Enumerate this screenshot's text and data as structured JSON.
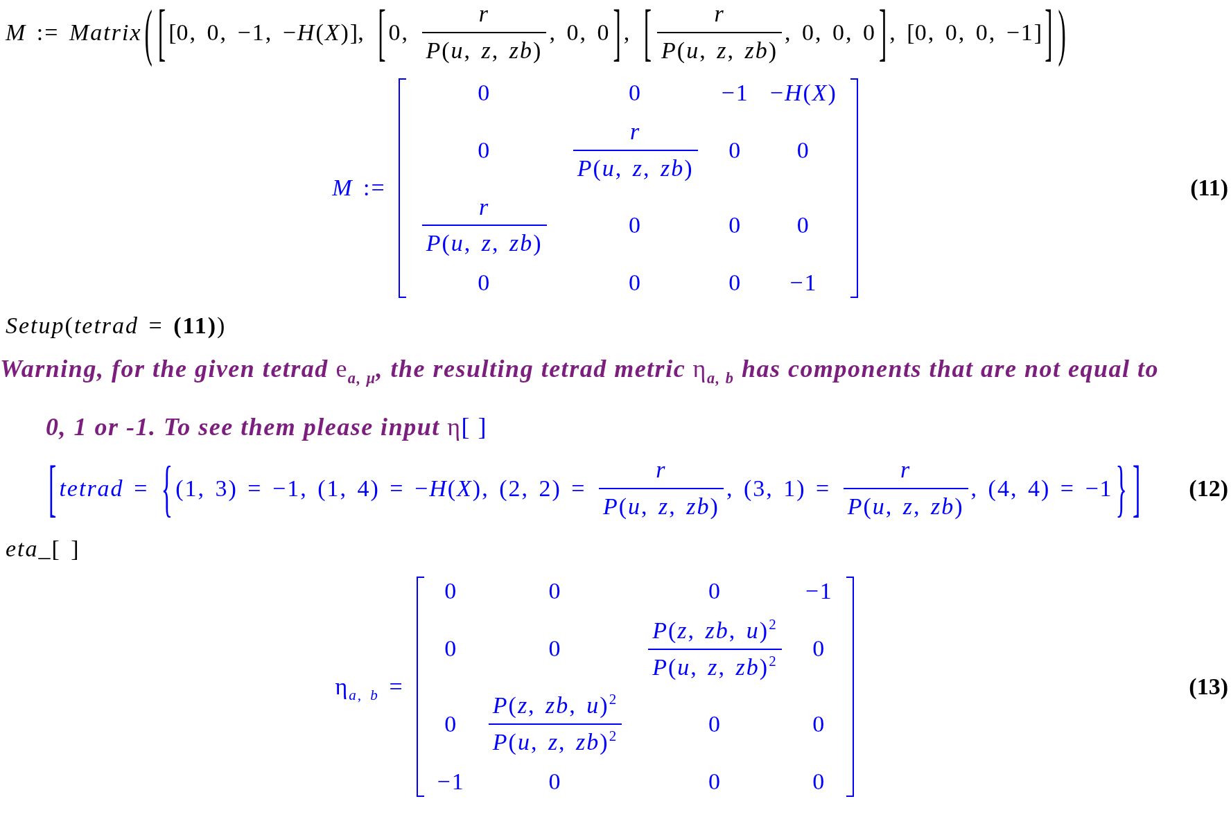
{
  "worksheet": [
    {
      "kind": "input",
      "expr": [
        {
          "kind": "text",
          "text": "*M* := *Matrix*"
        },
        {
          "kind": "fence",
          "open": "(",
          "close": ")",
          "body": [
            {
              "kind": "fence",
              "open": "[",
              "close": "]",
              "body": [
                {
                  "kind": "fence",
                  "open": "[",
                  "close": "]",
                  "body": [
                    {
                      "kind": "text",
                      "text": "0, 0, −1, −*H*(*X*)"
                    }
                  ]
                },
                {
                  "kind": "text",
                  "text": ", "
                },
                {
                  "kind": "fence",
                  "open": "[",
                  "close": "]",
                  "body": [
                    {
                      "kind": "text",
                      "text": "0, "
                    },
                    {
                      "kind": "frac",
                      "num": "*r*",
                      "den": "*P*(*u*, *z*, *zb*)"
                    },
                    {
                      "kind": "text",
                      "text": ", 0, 0"
                    }
                  ]
                },
                {
                  "kind": "text",
                  "text": ", "
                },
                {
                  "kind": "fence",
                  "open": "[",
                  "close": "]",
                  "body": [
                    {
                      "kind": "frac",
                      "num": "*r*",
                      "den": "*P*(*u*, *z*, *zb*)"
                    },
                    {
                      "kind": "text",
                      "text": ", 0, 0, 0"
                    }
                  ]
                },
                {
                  "kind": "text",
                  "text": ", "
                },
                {
                  "kind": "fence",
                  "open": "[",
                  "close": "]",
                  "body": [
                    {
                      "kind": "text",
                      "text": "0, 0, 0, −1"
                    }
                  ]
                }
              ]
            }
          ]
        }
      ]
    },
    {
      "kind": "output",
      "label": "(11)",
      "expr": [
        {
          "kind": "text",
          "text": "*M* :="
        },
        {
          "kind": "matrix",
          "rows": [
            [
              {
                "kind": "text",
                "text": "0"
              },
              {
                "kind": "text",
                "text": "0"
              },
              {
                "kind": "text",
                "text": "−1"
              },
              {
                "kind": "text",
                "text": "−*H*(*X*)"
              }
            ],
            [
              {
                "kind": "text",
                "text": "0"
              },
              {
                "kind": "frac",
                "num": "*r*",
                "den": "*P*(*u*, *z*, *zb*)"
              },
              {
                "kind": "text",
                "text": "0"
              },
              {
                "kind": "text",
                "text": "0"
              }
            ],
            [
              {
                "kind": "frac",
                "num": "*r*",
                "den": "*P*(*u*, *z*, *zb*)"
              },
              {
                "kind": "text",
                "text": "0"
              },
              {
                "kind": "text",
                "text": "0"
              },
              {
                "kind": "text",
                "text": "0"
              }
            ],
            [
              {
                "kind": "text",
                "text": "0"
              },
              {
                "kind": "text",
                "text": "0"
              },
              {
                "kind": "text",
                "text": "0"
              },
              {
                "kind": "text",
                "text": "−1"
              }
            ]
          ]
        }
      ]
    },
    {
      "kind": "input",
      "expr": [
        {
          "kind": "text",
          "text": "*Setup*(*tetrad* = **(11)**)"
        }
      ]
    },
    {
      "kind": "warning",
      "lines": [
        [
          {
            "kind": "text",
            "text": "Warning, for the given tetrad "
          },
          {
            "kind": "symbol",
            "text": "e$_{a, μ}$"
          },
          {
            "kind": "text",
            "text": ", the resulting tetrad metric "
          },
          {
            "kind": "symbol",
            "text": "η$_{a, b}$"
          },
          {
            "kind": "text",
            "text": " has components that are not equal to"
          }
        ],
        [
          {
            "kind": "text",
            "text": "0, 1 or -1. To see them please input "
          },
          {
            "kind": "symbol",
            "text": "η"
          },
          {
            "kind": "code",
            "text": "[ ]"
          }
        ]
      ]
    },
    {
      "kind": "output",
      "label": "(12)",
      "expr": [
        {
          "kind": "fence",
          "open": "[",
          "close": "]",
          "body": [
            {
              "kind": "text",
              "text": "*tetrad* = "
            },
            {
              "kind": "fence",
              "open": "{",
              "close": "}",
              "body": [
                {
                  "kind": "text",
                  "text": "(1, 3) = −1, (1, 4) = −*H*(*X*), (2, 2) = "
                },
                {
                  "kind": "frac",
                  "num": "*r*",
                  "den": "*P*(*u*, *z*, *zb*)"
                },
                {
                  "kind": "text",
                  "text": ", (3, 1) = "
                },
                {
                  "kind": "frac",
                  "num": "*r*",
                  "den": "*P*(*u*, *z*, *zb*)"
                },
                {
                  "kind": "text",
                  "text": ", (4, 4) = −1"
                }
              ]
            }
          ]
        }
      ]
    },
    {
      "kind": "input",
      "expr": [
        {
          "kind": "text",
          "text": "*eta_*[ ]"
        }
      ]
    },
    {
      "kind": "output",
      "label": "(13)",
      "expr": [
        {
          "kind": "text",
          "text": "η$_{a, b}$ ="
        },
        {
          "kind": "matrix",
          "rows": [
            [
              {
                "kind": "text",
                "text": "0"
              },
              {
                "kind": "text",
                "text": "0"
              },
              {
                "kind": "text",
                "text": "0"
              },
              {
                "kind": "text",
                "text": "−1"
              }
            ],
            [
              {
                "kind": "text",
                "text": "0"
              },
              {
                "kind": "text",
                "text": "0"
              },
              {
                "kind": "frac",
                "num": "*P*(*z*, *zb*, *u*)$^{2}$",
                "den": "*P*(*u*, *z*, *zb*)$^{2}$"
              },
              {
                "kind": "text",
                "text": "0"
              }
            ],
            [
              {
                "kind": "text",
                "text": "0"
              },
              {
                "kind": "frac",
                "num": "*P*(*z*, *zb*, *u*)$^{2}$",
                "den": "*P*(*u*, *z*, *zb*)$^{2}$"
              },
              {
                "kind": "text",
                "text": "0"
              },
              {
                "kind": "text",
                "text": "0"
              }
            ],
            [
              {
                "kind": "text",
                "text": "−1"
              },
              {
                "kind": "text",
                "text": "0"
              },
              {
                "kind": "text",
                "text": "0"
              },
              {
                "kind": "text",
                "text": "0"
              }
            ]
          ]
        }
      ]
    }
  ]
}
